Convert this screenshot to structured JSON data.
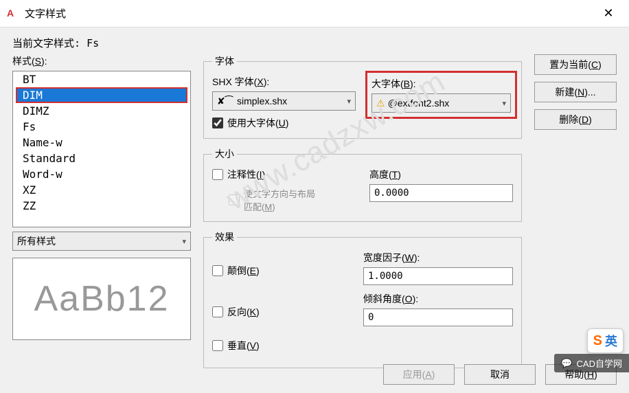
{
  "title": "文字样式",
  "current_style_label": "当前文字样式:",
  "current_style_value": "Fs",
  "styles_label": "样式(S):",
  "styles": [
    "BT",
    "DIM",
    "DIMZ",
    "Fs",
    "Name-w",
    "Standard",
    "Word-w",
    "XZ",
    "ZZ"
  ],
  "selected_style": "DIM",
  "filter_label": "所有样式",
  "preview_text": "AaBb12",
  "font_group": "字体",
  "shx_label": "SHX 字体(X):",
  "shx_value": "simplex.shx",
  "use_bigfont_label": "使用大字体(U)",
  "use_bigfont_checked": true,
  "bigfont_label": "大字体(B):",
  "bigfont_value": "@extfont2.shx",
  "size_group": "大小",
  "annotative_label": "注释性(I)",
  "annotative_checked": false,
  "match_orient_label": "使文字方向与布局匹配(M)",
  "height_label": "高度(T)",
  "height_value": "0.0000",
  "effects_group": "效果",
  "upside_label": "颠倒(E)",
  "backwards_label": "反向(K)",
  "vertical_label": "垂直(V)",
  "widthfactor_label": "宽度因子(W):",
  "widthfactor_value": "1.0000",
  "oblique_label": "倾斜角度(O):",
  "oblique_value": "0",
  "btn_setcurrent": "置为当前(C)",
  "btn_new": "新建(N)...",
  "btn_delete": "删除(D)",
  "btn_apply": "应用(A)",
  "btn_close": "取消",
  "btn_help": "帮助(H)",
  "watermark": "www.cadzxw.com",
  "ime_text": "英",
  "wechat_text": "CAD自学网"
}
